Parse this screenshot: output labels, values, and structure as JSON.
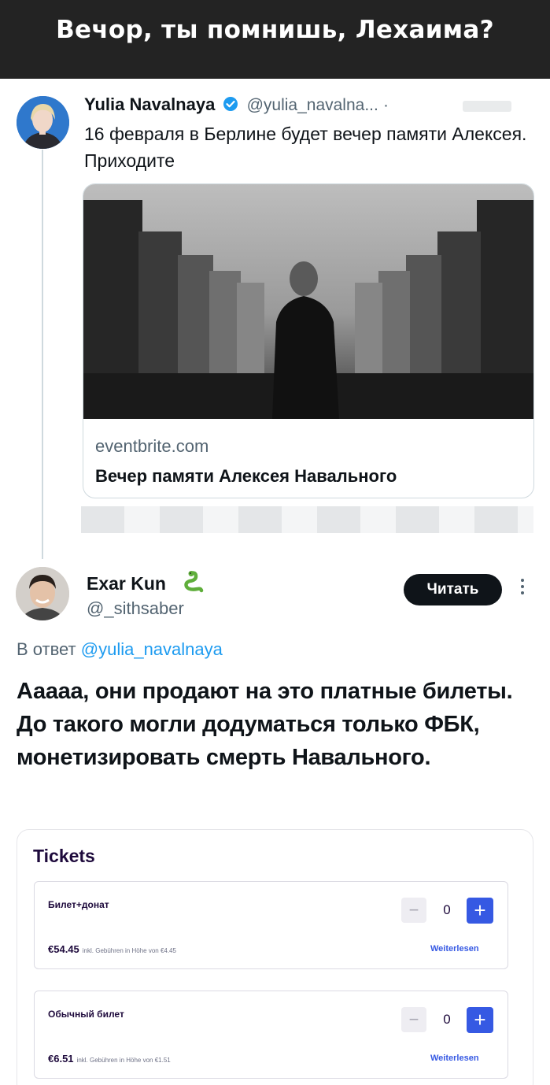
{
  "banner": {
    "caption": "Вечор, ты помнишь, Лехаима?"
  },
  "tweet1": {
    "author_name": "Yulia Navalnaya",
    "handle": "@yulia_navalna...",
    "separator": "·",
    "text": "16 февраля в Берлине будет вечер памяти Алексея. Приходите",
    "card": {
      "domain": "eventbrite.com",
      "title": "Вечер памяти Алексея Навального"
    }
  },
  "tweet2": {
    "author_name": "Exar Kun",
    "handle": "@_sithsaber",
    "follow_label": "Читать",
    "reply_prefix": "В ответ ",
    "reply_mention": "@yulia_navalnaya",
    "text": "Ааааа, они продают на это платные билеты. До такого могли додуматься только ФБК, монетизировать смерть Навального."
  },
  "tickets": {
    "title": "Tickets",
    "items": [
      {
        "name": "Билет+донат",
        "price": "€54.45",
        "fee": "inkl. Gebühren in Höhe von €4.45",
        "quantity": "0",
        "read_more": "Weiterlesen"
      },
      {
        "name": "Обычный билет",
        "price": "€6.51",
        "fee": "inkl. Gebühren in Höhe von €1.51",
        "quantity": "0",
        "read_more": "Weiterlesen"
      }
    ]
  },
  "colors": {
    "accent_blue": "#1d9bf0",
    "ticket_blue": "#3659e3",
    "follow_bg": "#0f1419",
    "banner_bg": "#232323"
  },
  "icons": [
    "verified-badge-icon",
    "snake-emoji-icon",
    "more-options-icon",
    "minus-icon",
    "plus-icon"
  ]
}
